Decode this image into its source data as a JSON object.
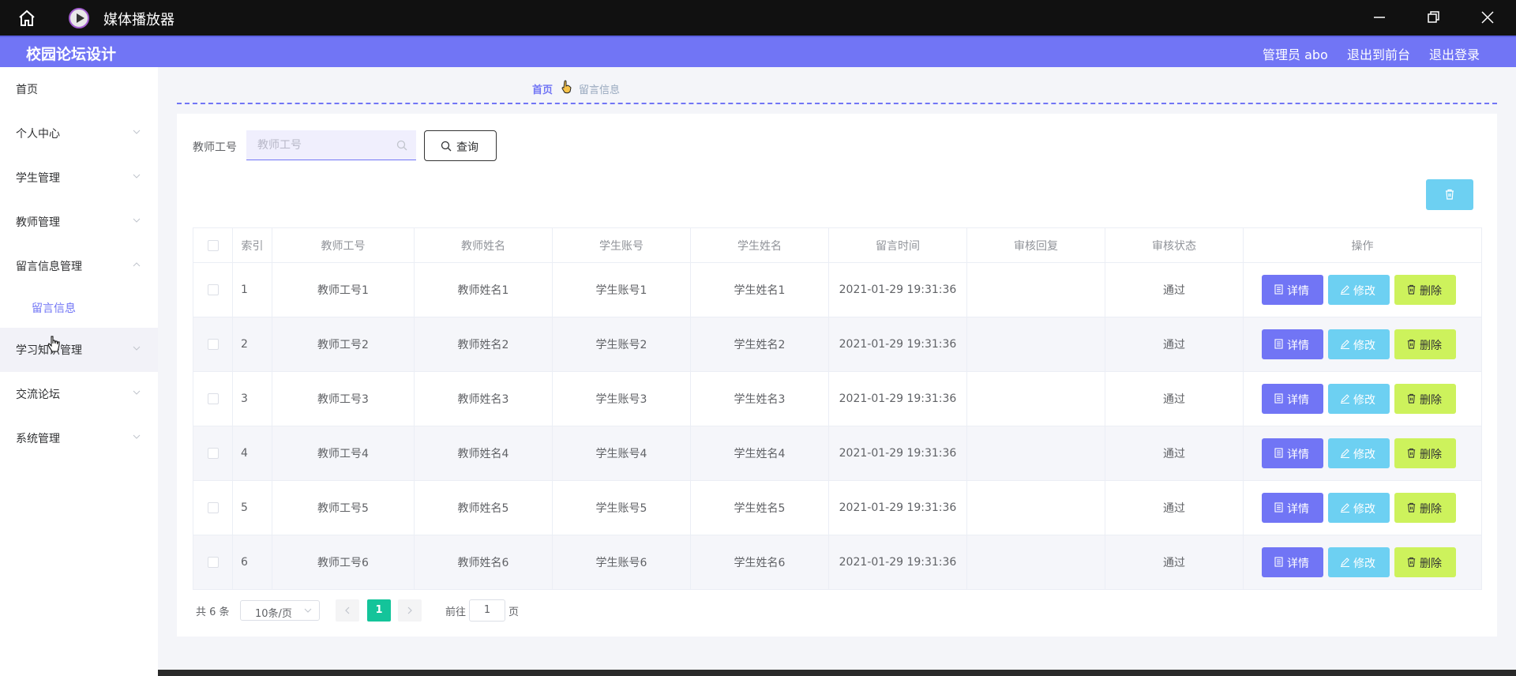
{
  "window": {
    "title": "媒体播放器"
  },
  "header": {
    "brand": "校园论坛设计",
    "links": [
      "管理员 abo",
      "退出到前台",
      "退出登录"
    ]
  },
  "sidebar": {
    "items": [
      {
        "label": "首页"
      },
      {
        "label": "个人中心"
      },
      {
        "label": "学生管理"
      },
      {
        "label": "教师管理"
      },
      {
        "label": "留言信息管理"
      },
      {
        "label": "学习知识管理"
      },
      {
        "label": "交流论坛"
      },
      {
        "label": "系统管理"
      }
    ],
    "sub_items": [
      {
        "label": "留言信息"
      }
    ]
  },
  "breadcrumb": {
    "home": "首页",
    "current": "留言信息"
  },
  "search": {
    "label": "教师工号",
    "placeholder": "教师工号",
    "value": "",
    "button": "查询"
  },
  "table": {
    "columns": [
      "",
      "索引",
      "教师工号",
      "教师姓名",
      "学生账号",
      "学生姓名",
      "留言时间",
      "审核回复",
      "审核状态",
      "操作"
    ],
    "rows": [
      {
        "idx": "1",
        "teacher_no": "教师工号1",
        "teacher_name": "教师姓名1",
        "student_account": "学生账号1",
        "student_name": "学生姓名1",
        "time": "2021-01-29 19:31:36",
        "reply": "",
        "status": "通过"
      },
      {
        "idx": "2",
        "teacher_no": "教师工号2",
        "teacher_name": "教师姓名2",
        "student_account": "学生账号2",
        "student_name": "学生姓名2",
        "time": "2021-01-29 19:31:36",
        "reply": "",
        "status": "通过"
      },
      {
        "idx": "3",
        "teacher_no": "教师工号3",
        "teacher_name": "教师姓名3",
        "student_account": "学生账号3",
        "student_name": "学生姓名3",
        "time": "2021-01-29 19:31:36",
        "reply": "",
        "status": "通过"
      },
      {
        "idx": "4",
        "teacher_no": "教师工号4",
        "teacher_name": "教师姓名4",
        "student_account": "学生账号4",
        "student_name": "学生姓名4",
        "time": "2021-01-29 19:31:36",
        "reply": "",
        "status": "通过"
      },
      {
        "idx": "5",
        "teacher_no": "教师工号5",
        "teacher_name": "教师姓名5",
        "student_account": "学生账号5",
        "student_name": "学生姓名5",
        "time": "2021-01-29 19:31:36",
        "reply": "",
        "status": "通过"
      },
      {
        "idx": "6",
        "teacher_no": "教师工号6",
        "teacher_name": "教师姓名6",
        "student_account": "学生账号6",
        "student_name": "学生姓名6",
        "time": "2021-01-29 19:31:36",
        "reply": "",
        "status": "通过"
      }
    ],
    "actions": {
      "detail": "详情",
      "edit": "修改",
      "delete": "删除"
    }
  },
  "pagination": {
    "total": "共 6 条",
    "page_size": "10条/页",
    "current_page": "1",
    "goto_label": "前往",
    "goto_value": "1",
    "page_suffix": "页"
  },
  "colors": {
    "accent": "#7175f5",
    "info": "#6dd0f2",
    "danger_btn": "#cdf25c",
    "active_page": "#14c49a"
  },
  "icons": [
    "home-icon",
    "media-player-icon",
    "minimize-icon",
    "maximize-icon",
    "close-icon",
    "search-icon",
    "trash-icon",
    "document-icon",
    "edit-icon",
    "chevron-down-icon",
    "chevron-up-icon"
  ]
}
